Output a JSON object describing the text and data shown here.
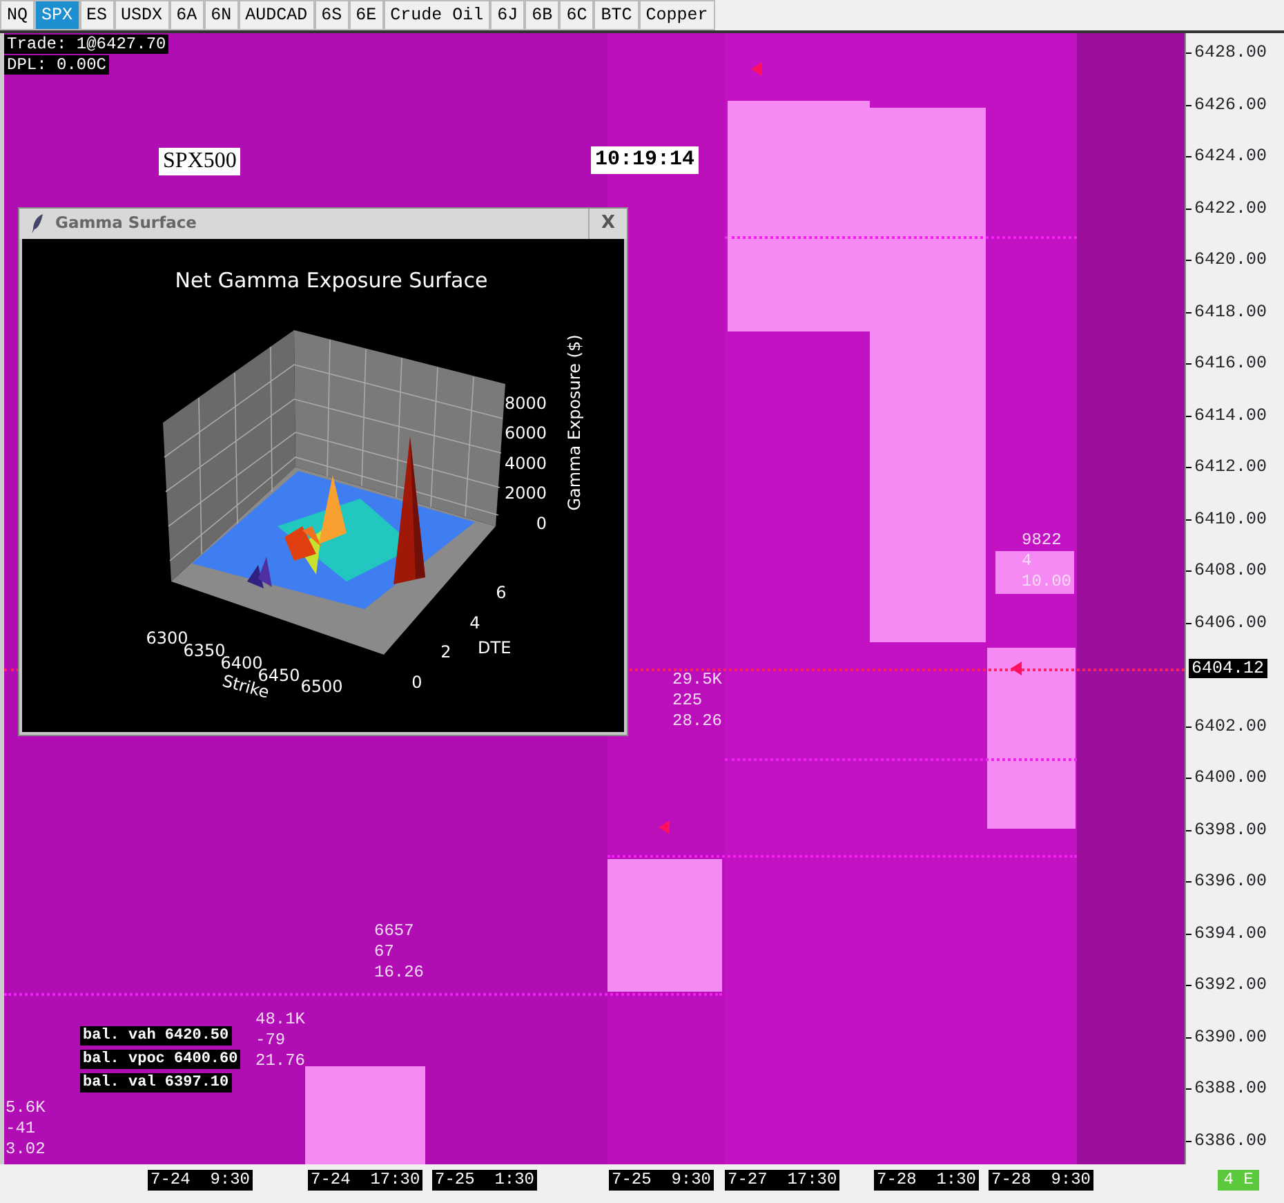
{
  "tabs": [
    {
      "label": "NQ",
      "selected": false
    },
    {
      "label": "SPX",
      "selected": true
    },
    {
      "label": "ES",
      "selected": false
    },
    {
      "label": "USDX",
      "selected": false
    },
    {
      "label": "6A",
      "selected": false
    },
    {
      "label": "6N",
      "selected": false
    },
    {
      "label": "AUDCAD",
      "selected": false
    },
    {
      "label": "6S",
      "selected": false
    },
    {
      "label": "6E",
      "selected": false
    },
    {
      "label": "Crude Oil",
      "selected": false
    },
    {
      "label": "6J",
      "selected": false
    },
    {
      "label": "6B",
      "selected": false
    },
    {
      "label": "6C",
      "selected": false
    },
    {
      "label": "BTC",
      "selected": false
    },
    {
      "label": "Copper",
      "selected": false
    }
  ],
  "info": [
    "Trade: 1@6427.70",
    "DPL: 0.00C"
  ],
  "symbol": "SPX500",
  "clock": "10:19:14",
  "gamma_window": {
    "title": "Gamma Surface",
    "close": "X",
    "chart_title": "Net Gamma Exposure Surface",
    "z_label": "Gamma Exposure ($)",
    "z_ticks": [
      "8000",
      "6000",
      "4000",
      "2000",
      "0"
    ],
    "x_label": "Strike",
    "x_ticks": [
      "6300",
      "6350",
      "6400",
      "6450",
      "6500"
    ],
    "y_label": "DTE",
    "y_ticks": [
      "0",
      "2",
      "4",
      "6"
    ]
  },
  "stats": [
    [
      "29.5K",
      "225",
      "28.26"
    ],
    [
      "6657",
      "67",
      "16.26"
    ],
    [
      "48.1K",
      "-79",
      "21.76"
    ],
    [
      "5.6K",
      "-41",
      "3.02"
    ],
    [
      "9822",
      "4",
      "10.00"
    ]
  ],
  "levels": [
    "bal. vah 6420.50",
    "bal. vpoc 6400.60",
    "bal. val 6397.10"
  ],
  "price_axis": [
    "6428.00",
    "6426.00",
    "6424.00",
    "6422.00",
    "6420.00",
    "6418.00",
    "6416.00",
    "6414.00",
    "6412.00",
    "6410.00",
    "6408.00",
    "6406.00",
    "6402.00",
    "6400.00",
    "6398.00",
    "6396.00",
    "6394.00",
    "6392.00",
    "6390.00",
    "6388.00",
    "6386.00"
  ],
  "last_price": "6404.12",
  "time_axis": [
    "7-24  9:30",
    "7-24  17:30",
    "7-25  1:30",
    "7-25  9:30",
    "7-27  17:30",
    "7-28  1:30",
    "7-28  9:30"
  ],
  "status": "4 E"
}
